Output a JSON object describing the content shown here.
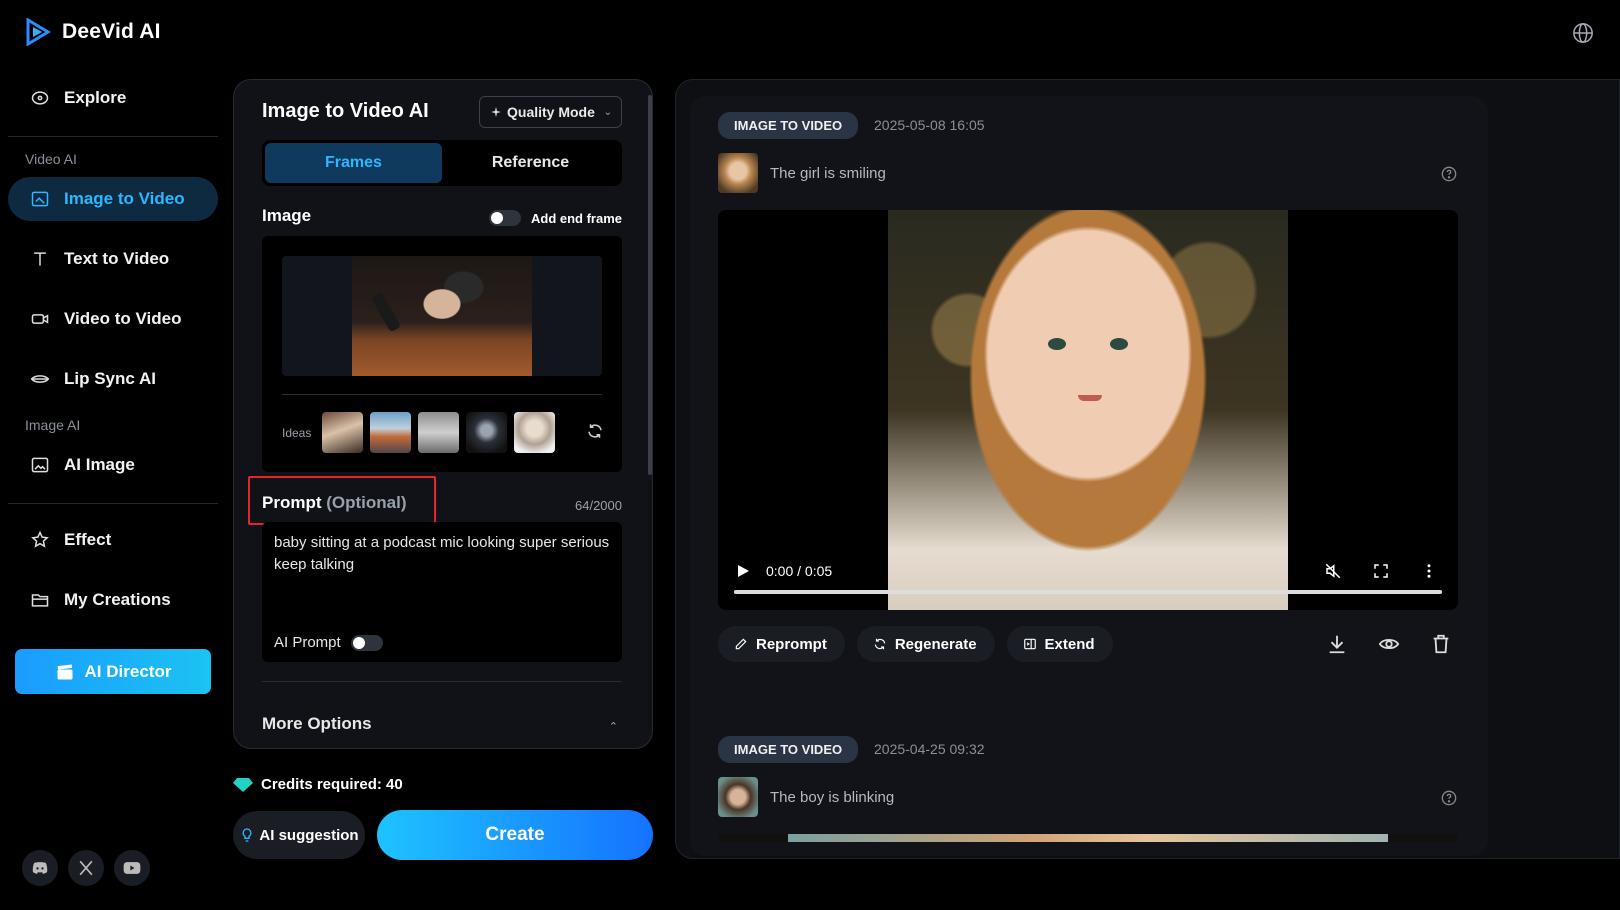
{
  "app": {
    "name": "DeeVid AI"
  },
  "sidebar": {
    "explore": "Explore",
    "group_video": "Video AI",
    "items_video": [
      {
        "label": "Image to Video",
        "icon": "image-icon",
        "active": true
      },
      {
        "label": "Text to Video",
        "icon": "text-icon",
        "active": false
      },
      {
        "label": "Video to Video",
        "icon": "video-camera-icon",
        "active": false
      },
      {
        "label": "Lip Sync AI",
        "icon": "lips-icon",
        "active": false
      }
    ],
    "group_image": "Image AI",
    "ai_image": "AI Image",
    "effect": "Effect",
    "my_creations": "My Creations",
    "ai_director": "AI Director",
    "social": [
      "discord-icon",
      "x-icon",
      "youtube-icon"
    ]
  },
  "panel": {
    "title": "Image to Video AI",
    "quality_mode": "Quality Mode",
    "tabs": [
      {
        "label": "Frames",
        "active": true
      },
      {
        "label": "Reference",
        "active": false
      }
    ],
    "image_label": "Image",
    "add_end_frame": "Add end frame",
    "ideas_label": "Ideas",
    "prompt_label": "Prompt",
    "prompt_optional": "(Optional)",
    "prompt_count": "64/2000",
    "prompt_text": "baby sitting at a podcast mic looking super serious keep talking",
    "ai_prompt": "AI Prompt",
    "more_options": "More Options"
  },
  "footer": {
    "credits": "Credits required: 40",
    "ai_suggestion": "AI suggestion",
    "create": "Create"
  },
  "results": [
    {
      "badge": "IMAGE TO VIDEO",
      "date": "2025-05-08 16:05",
      "caption": "The girl is smiling",
      "player": {
        "time": "0:00 / 0:05",
        "progress": 0.0
      },
      "actions": [
        "Reprompt",
        "Regenerate",
        "Extend"
      ]
    },
    {
      "badge": "IMAGE TO VIDEO",
      "date": "2025-04-25 09:32",
      "caption": "The boy is blinking"
    }
  ],
  "colors": {
    "accent": "#2bb6ff",
    "create_start": "#1ec3ff",
    "create_end": "#1572ff",
    "highlight": "#e3262d"
  }
}
